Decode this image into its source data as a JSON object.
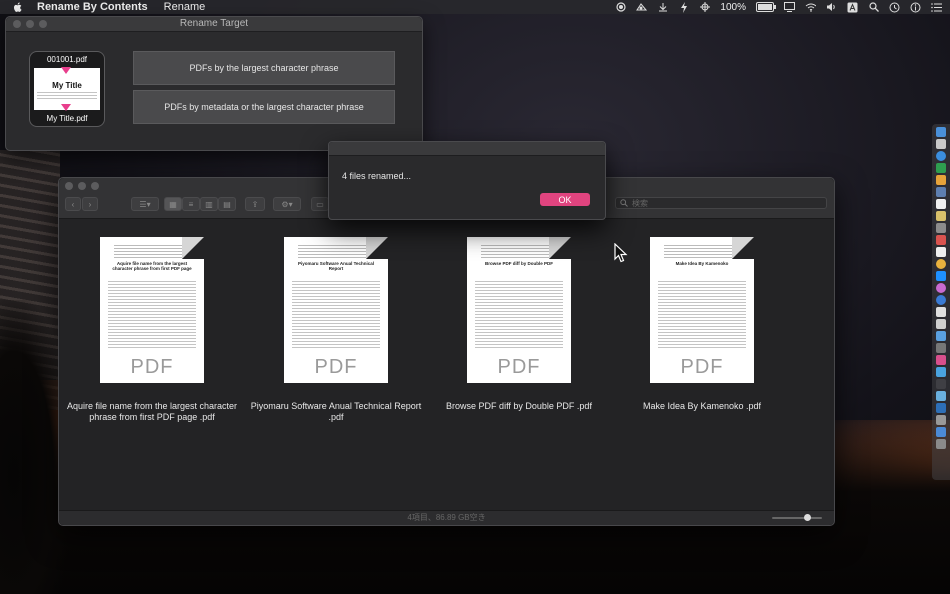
{
  "menubar": {
    "app_name": "Rename By Contents",
    "menu_rename": "Rename",
    "battery_percent": "100%",
    "battery_level": 100
  },
  "rename_target": {
    "window_title": "Rename Target",
    "icon_top_label": "001001.pdf",
    "icon_title": "My Title",
    "icon_bottom_label": "My Title.pdf",
    "button_largest": "PDFs by the largest character phrase",
    "button_metadata": "PDFs by metadata or the largest character phrase"
  },
  "alert": {
    "message": "4 files renamed...",
    "ok_label": "OK",
    "accent": "#e0447f"
  },
  "finder": {
    "search_placeholder": "検索",
    "status_text": "4項目、86.89 GB空き",
    "zoom_level": 0.7,
    "files": [
      {
        "name": "Aquire file name from the largest character phrase from first PDF page .pdf",
        "doc_title": "Aquire file name from the largest character phrase from first PDF page",
        "doc_type": "PDF"
      },
      {
        "name": "Piyomaru Software Anual Technical Report .pdf",
        "doc_title": "Piyomaru Software Anual Technical Report",
        "doc_type": "PDF"
      },
      {
        "name": "Browse PDF diff by Double PDF .pdf",
        "doc_title": "Browse PDF diff by Double PDF",
        "doc_type": "PDF"
      },
      {
        "name": "Make Idea By Kamenoko .pdf",
        "doc_title": "Make Idea By Kamenoko",
        "doc_type": "PDF"
      }
    ]
  },
  "icons": {
    "menubar_status": [
      "record-icon",
      "screenshot-icon",
      "download-icon",
      "bolt-icon",
      "crosshair-icon",
      "battery-icon",
      "display-icon",
      "wifi-icon",
      "volume-icon",
      "input-source-icon",
      "spotlight-icon",
      "time-machine-icon",
      "info-icon",
      "control-list-icon"
    ]
  }
}
